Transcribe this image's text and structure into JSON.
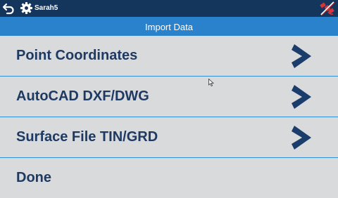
{
  "topbar": {
    "project_name": "Sarah5",
    "icons": [
      "back-arrow-icon",
      "gear-icon",
      "satellite-disconnected-icon"
    ]
  },
  "title": "Import Data",
  "menu": {
    "items": [
      {
        "label": "Point Coordinates",
        "icon": "chevron-right-icon"
      },
      {
        "label": "AutoCAD DXF/DWG",
        "icon": "chevron-right-icon"
      },
      {
        "label": "Surface File TIN/GRD",
        "icon": "chevron-right-icon"
      },
      {
        "label": "Done"
      }
    ]
  },
  "colors": {
    "topbar": "#15365c",
    "titlebar": "#2a82cc",
    "background": "#d9dadb",
    "item_text": "#1e3a63",
    "chevron": "#1b3d6b",
    "divider": "#2f8fd8",
    "satellite_status": "#d9343c"
  }
}
